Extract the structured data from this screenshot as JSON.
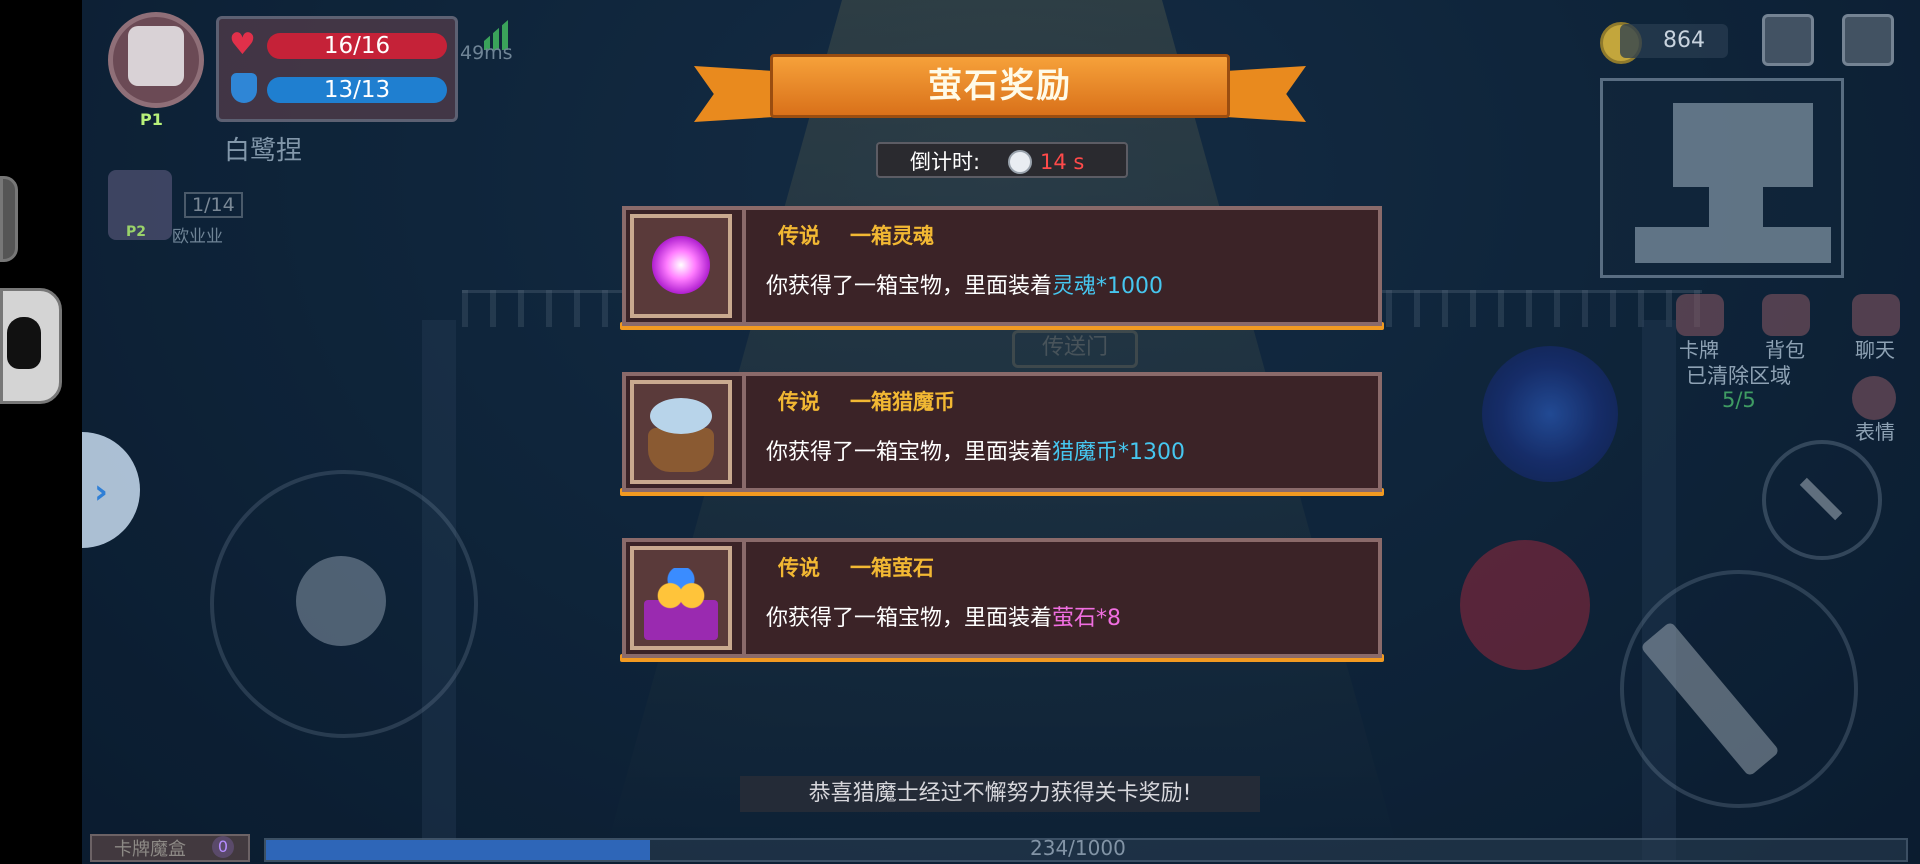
{
  "hud": {
    "hp": "16/16",
    "mp": "13/13",
    "ping": "49ms",
    "player_name": "白鹭捏",
    "p1_badge": "P1",
    "p2_badge": "P2",
    "p2_name": "欧业业",
    "p2_progress": "1/14",
    "coins": "864"
  },
  "side_menu": {
    "cards": "卡牌",
    "bag": "背包",
    "chat": "聊天",
    "emote": "表情",
    "cleared_label": "已清除区域",
    "cleared_value": "5/5"
  },
  "map": {
    "portal_sign": "传送门"
  },
  "dialog": {
    "title": "萤石奖励",
    "countdown_label": "倒计时:",
    "countdown_value": "14 s",
    "rewards": [
      {
        "rarity": "传说",
        "name": "一箱灵魂",
        "desc_prefix": "你获得了一箱宝物，里面装着",
        "item": "灵魂*1000",
        "icon": "soul-orb-icon",
        "color": "#46c6ef"
      },
      {
        "rarity": "传说",
        "name": "一箱猎魔币",
        "desc_prefix": "你获得了一箱宝物，里面装着",
        "item": "猎魔币*1300",
        "icon": "coin-sack-icon",
        "color": "#46c6ef"
      },
      {
        "rarity": "传说",
        "name": "一箱萤石",
        "desc_prefix": "你获得了一箱宝物，里面装着",
        "item": "萤石*8",
        "icon": "gem-pile-icon",
        "color": "#f06ee0"
      }
    ],
    "congrats": "恭喜猎魔士经过不懈努力获得关卡奖励!"
  },
  "bottom": {
    "card_box_label": "卡牌魔盒",
    "card_box_count": "0",
    "xp_text": "234/1000",
    "xp_fraction": 0.234
  },
  "colors": {
    "banner": "#e98a1e",
    "rarity_gold": "#f2b833",
    "countdown_red": "#ff4a4a"
  }
}
